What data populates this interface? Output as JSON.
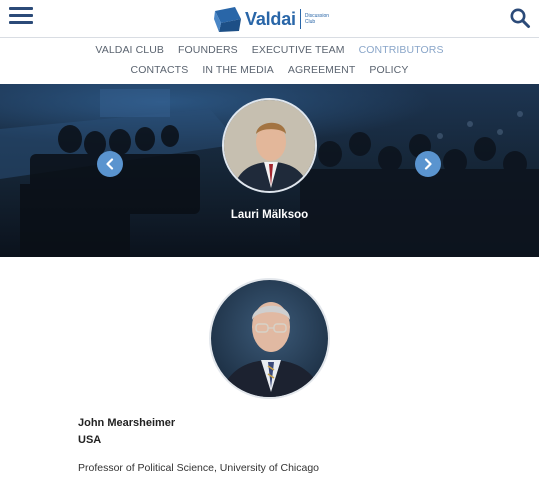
{
  "header": {
    "logo_word": "Valdai",
    "logo_sub": "Discussion Club"
  },
  "nav": {
    "row1": [
      "VALDAI CLUB",
      "FOUNDERS",
      "EXECUTIVE TEAM",
      "CONTRIBUTORS"
    ],
    "row2": [
      "CONTACTS",
      "IN THE MEDIA",
      "AGREEMENT",
      "POLICY"
    ],
    "active": "CONTRIBUTORS"
  },
  "carousel": {
    "name": "Lauri Mälksoo"
  },
  "profile": {
    "name": "John Mearsheimer",
    "country": "USA",
    "position": "Professor of Political Science, University of Chicago"
  },
  "colors": {
    "brand": "#2966a8",
    "nav_active": "#8aa6c9",
    "arrow": "#5a94cf"
  },
  "icons": [
    "menu-icon",
    "search-icon",
    "chevron-left-icon",
    "chevron-right-icon"
  ]
}
